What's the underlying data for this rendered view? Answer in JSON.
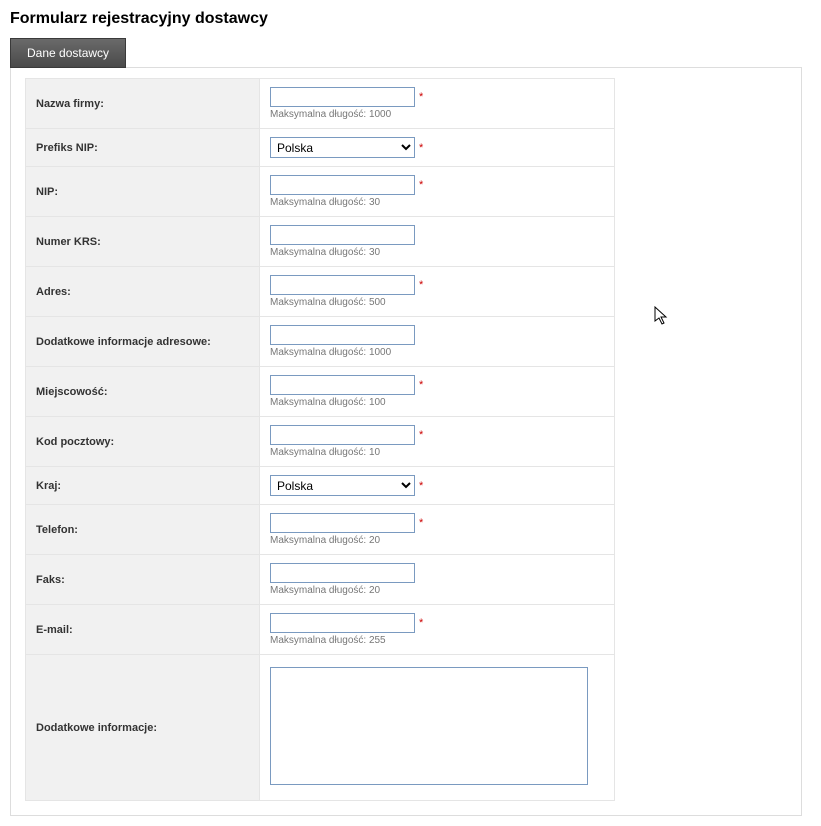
{
  "page_title": "Formularz rejestracyjny dostawcy",
  "tab_label": "Dane dostawcy",
  "hint_prefix": "Maksymalna długość:",
  "fields": {
    "nazwa_firmy": {
      "label": "Nazwa firmy:",
      "type": "text",
      "required": true,
      "max": "1000",
      "value": ""
    },
    "prefiks_nip": {
      "label": "Prefiks NIP:",
      "type": "select",
      "required": true,
      "selected": "Polska"
    },
    "nip": {
      "label": "NIP:",
      "type": "text",
      "required": true,
      "max": "30",
      "value": ""
    },
    "numer_krs": {
      "label": "Numer KRS:",
      "type": "text",
      "required": false,
      "max": "30",
      "value": ""
    },
    "adres": {
      "label": "Adres:",
      "type": "text",
      "required": true,
      "max": "500",
      "value": ""
    },
    "dod_adres": {
      "label": "Dodatkowe informacje adresowe:",
      "type": "text",
      "required": false,
      "max": "1000",
      "value": ""
    },
    "miejscowosc": {
      "label": "Miejscowość:",
      "type": "text",
      "required": true,
      "max": "100",
      "value": ""
    },
    "kod_pocztowy": {
      "label": "Kod pocztowy:",
      "type": "text",
      "required": true,
      "max": "10",
      "value": ""
    },
    "kraj": {
      "label": "Kraj:",
      "type": "select",
      "required": true,
      "selected": "Polska"
    },
    "telefon": {
      "label": "Telefon:",
      "type": "text",
      "required": true,
      "max": "20",
      "value": ""
    },
    "faks": {
      "label": "Faks:",
      "type": "text",
      "required": false,
      "max": "20",
      "value": ""
    },
    "email": {
      "label": "E-mail:",
      "type": "text",
      "required": true,
      "max": "255",
      "value": ""
    },
    "dod_info": {
      "label": "Dodatkowe informacje:",
      "type": "textarea",
      "required": false,
      "value": ""
    }
  },
  "required_marker": "*"
}
